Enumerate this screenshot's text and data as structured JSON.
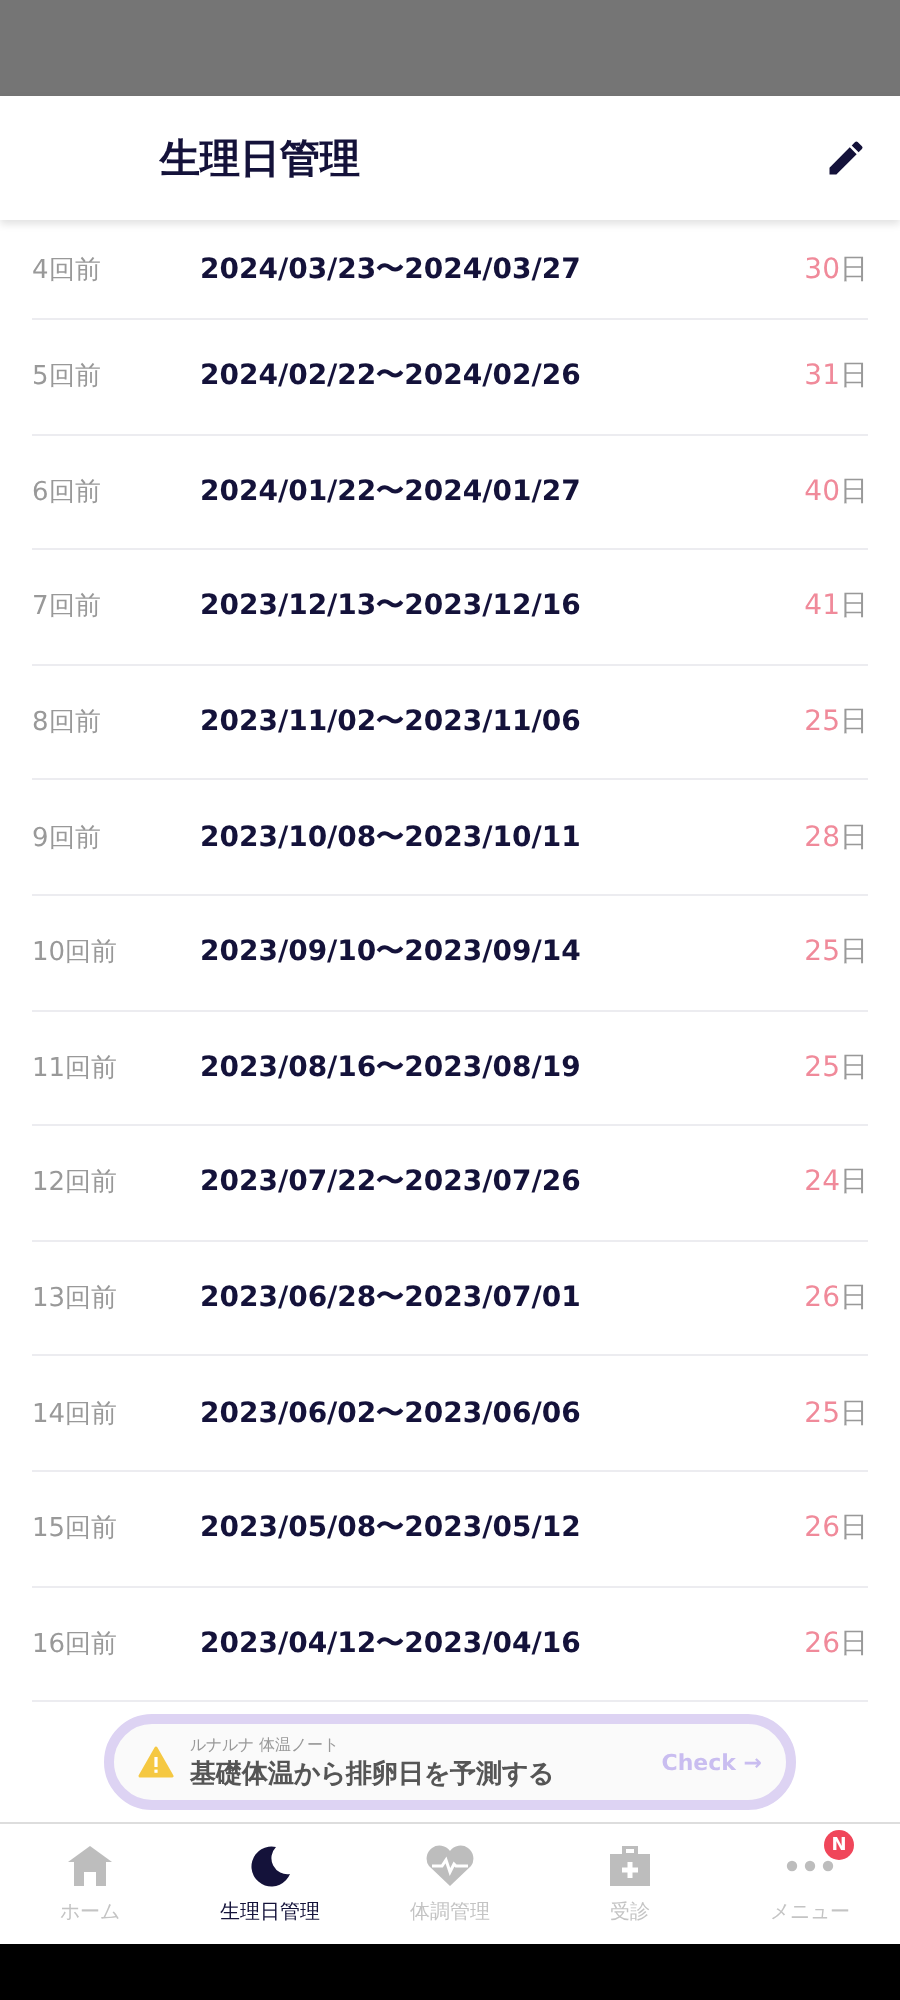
{
  "header": {
    "title": "生理日管理"
  },
  "cycles": [
    {
      "label": "4回前",
      "range": "2024/03/23〜2024/03/27",
      "days": "30",
      "unit": "日"
    },
    {
      "label": "5回前",
      "range": "2024/02/22〜2024/02/26",
      "days": "31",
      "unit": "日"
    },
    {
      "label": "6回前",
      "range": "2024/01/22〜2024/01/27",
      "days": "40",
      "unit": "日"
    },
    {
      "label": "7回前",
      "range": "2023/12/13〜2023/12/16",
      "days": "41",
      "unit": "日"
    },
    {
      "label": "8回前",
      "range": "2023/11/02〜2023/11/06",
      "days": "25",
      "unit": "日"
    },
    {
      "label": "9回前",
      "range": "2023/10/08〜2023/10/11",
      "days": "28",
      "unit": "日"
    },
    {
      "label": "10回前",
      "range": "2023/09/10〜2023/09/14",
      "days": "25",
      "unit": "日"
    },
    {
      "label": "11回前",
      "range": "2023/08/16〜2023/08/19",
      "days": "25",
      "unit": "日"
    },
    {
      "label": "12回前",
      "range": "2023/07/22〜2023/07/26",
      "days": "24",
      "unit": "日"
    },
    {
      "label": "13回前",
      "range": "2023/06/28〜2023/07/01",
      "days": "26",
      "unit": "日"
    },
    {
      "label": "14回前",
      "range": "2023/06/02〜2023/06/06",
      "days": "25",
      "unit": "日"
    },
    {
      "label": "15回前",
      "range": "2023/05/08〜2023/05/12",
      "days": "26",
      "unit": "日"
    },
    {
      "label": "16回前",
      "range": "2023/04/12〜2023/04/16",
      "days": "26",
      "unit": "日"
    }
  ],
  "banner": {
    "caption": "ルナルナ 体温ノート",
    "text": "基礎体温から排卵日を予測する",
    "action": "Check →"
  },
  "nav": [
    {
      "kind": "home",
      "label": "ホーム",
      "selected": false
    },
    {
      "kind": "moon",
      "label": "生理日管理",
      "selected": true
    },
    {
      "kind": "heart",
      "label": "体調管理",
      "selected": false
    },
    {
      "kind": "clinic",
      "label": "受診",
      "selected": false
    },
    {
      "kind": "menu",
      "label": "メニュー",
      "selected": false,
      "badge": "N"
    }
  ]
}
